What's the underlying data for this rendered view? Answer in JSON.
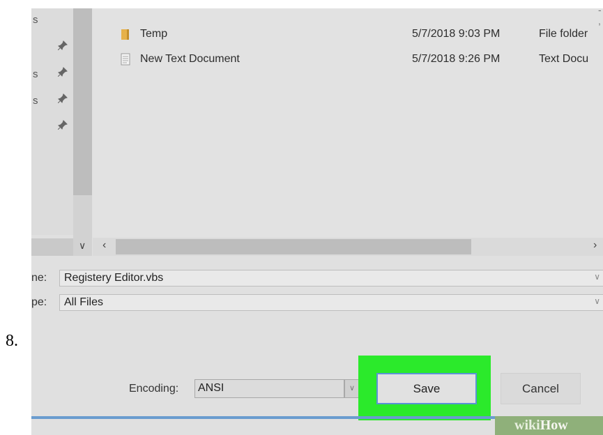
{
  "step_number": "8.",
  "nav_fragments": [
    "s",
    "s",
    "s"
  ],
  "files": [
    {
      "icon": "folder-icon",
      "name": "Temp",
      "date": "5/7/2018 9:03 PM",
      "type": "File folder"
    },
    {
      "icon": "text-document-icon",
      "name": "New Text Document",
      "date": "5/7/2018 9:26 PM",
      "type": "Text Docu"
    }
  ],
  "file_name": {
    "label": "ne:",
    "value": "Registery Editor.vbs"
  },
  "save_type": {
    "label": "pe:",
    "value": "All Files"
  },
  "encoding": {
    "label": "Encoding:",
    "value": "ANSI"
  },
  "buttons": {
    "save": "Save",
    "cancel": "Cancel"
  },
  "watermark": {
    "wiki": "wiki",
    "how": "How"
  },
  "colors": {
    "highlight": "#2bea2b",
    "save_border": "#5b93d6",
    "folder": "#e6b14a"
  }
}
